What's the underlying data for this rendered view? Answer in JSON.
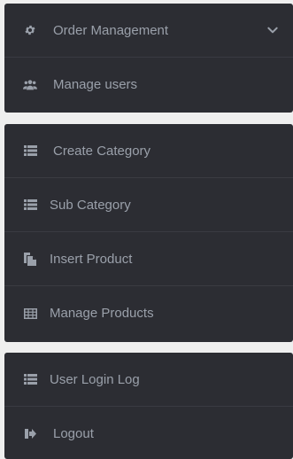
{
  "menu": {
    "group1": [
      {
        "label": "Order Management",
        "icon": "gear-icon"
      },
      {
        "label": "Manage users",
        "icon": "users-icon"
      }
    ],
    "group2": [
      {
        "label": "Create Category",
        "icon": "list-icon"
      },
      {
        "label": "Sub Category",
        "icon": "list-icon"
      },
      {
        "label": "Insert Product",
        "icon": "copy-icon"
      },
      {
        "label": "Manage Products",
        "icon": "table-icon"
      }
    ],
    "group3": [
      {
        "label": "User Login Log",
        "icon": "list-icon"
      },
      {
        "label": "Logout",
        "icon": "logout-icon"
      }
    ]
  },
  "colors": {
    "panel": "#2c2d33",
    "text": "#9aa0aa",
    "background": "#efefef"
  }
}
